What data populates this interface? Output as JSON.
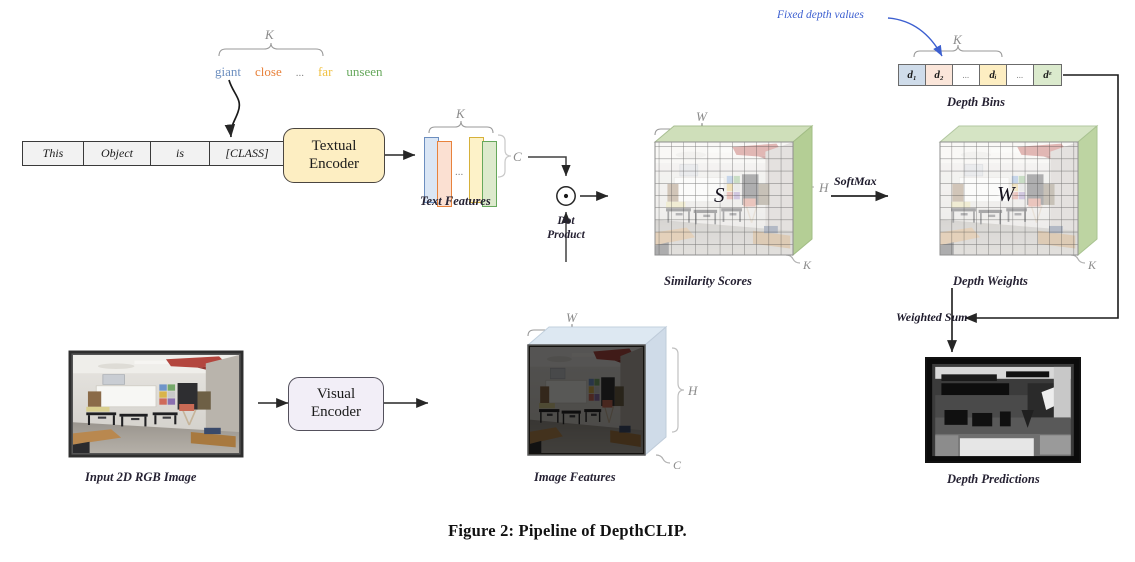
{
  "figure": {
    "caption": "Figure 2: Pipeline of DepthCLIP."
  },
  "prompt": {
    "tokens": [
      "This",
      "Object",
      "is",
      "[CLASS]"
    ]
  },
  "class_words": {
    "bracket_label": "K",
    "items": [
      {
        "text": "giant",
        "color": "#6c8ebf"
      },
      {
        "text": "close",
        "color": "#e8823c"
      },
      {
        "text": "...",
        "color": "#8a8a8a"
      },
      {
        "text": "far",
        "color": "#f0c040"
      },
      {
        "text": "unseen",
        "color": "#66a85c"
      }
    ]
  },
  "annotation": {
    "fixed_depth_values": "Fixed depth values"
  },
  "encoders": {
    "textual": {
      "line1": "Textual",
      "line2": "Encoder",
      "fill": "#fdeec2"
    },
    "visual": {
      "line1": "Visual",
      "line2": "Encoder",
      "fill": "#f2eef7"
    }
  },
  "text_features": {
    "label": "Text Features",
    "bracket_top": "K",
    "bracket_right": "C",
    "ellipsis": "...",
    "bars": [
      {
        "fill": "#dae6f5",
        "stroke": "#6c8ebf"
      },
      {
        "fill": "#fbe0d2",
        "stroke": "#e8823c"
      },
      {
        "fill": "#fdf2c8",
        "stroke": "#d6b13a"
      },
      {
        "fill": "#ddeacd",
        "stroke": "#66a85c"
      }
    ]
  },
  "dot_product": {
    "symbol": "⊙",
    "label_line1": "Dot",
    "label_line2": "Product"
  },
  "similarity_scores": {
    "label": "Similarity Scores",
    "letter": "S",
    "dim_top": "W",
    "dim_right": "H",
    "dim_depth": "K",
    "top_face": "#cfdfba",
    "side_face": "#b4ce95"
  },
  "depth_weights": {
    "label": "Depth Weights",
    "letter": "W",
    "dim_depth": "K",
    "top_face": "#d5e4c4",
    "side_face": "#bdd4a2"
  },
  "depth_bins": {
    "label": "Depth Bins",
    "bracket_label": "K",
    "cells": [
      {
        "text": "d₁",
        "fill": "#cfdcea"
      },
      {
        "text": "d₂",
        "fill": "#fbe6da"
      },
      {
        "text": "...",
        "fill": "#ffffff"
      },
      {
        "text": "dᵢ",
        "fill": "#fdeec2"
      },
      {
        "text": "...",
        "fill": "#ffffff"
      },
      {
        "text": "dᵋ",
        "fill": "#dbeacd"
      }
    ]
  },
  "image_features": {
    "label": "Image Features",
    "dim_top": "W",
    "dim_right": "H",
    "dim_depth": "C",
    "top_face": "#dde8f2",
    "side_face": "#cfdbe8"
  },
  "input_image": {
    "label": "Input 2D RGB Image"
  },
  "depth_predictions": {
    "label": "Depth Predictions"
  },
  "operations": {
    "softmax": "SoftMax",
    "weighted_sum": "Weighted Sum"
  }
}
